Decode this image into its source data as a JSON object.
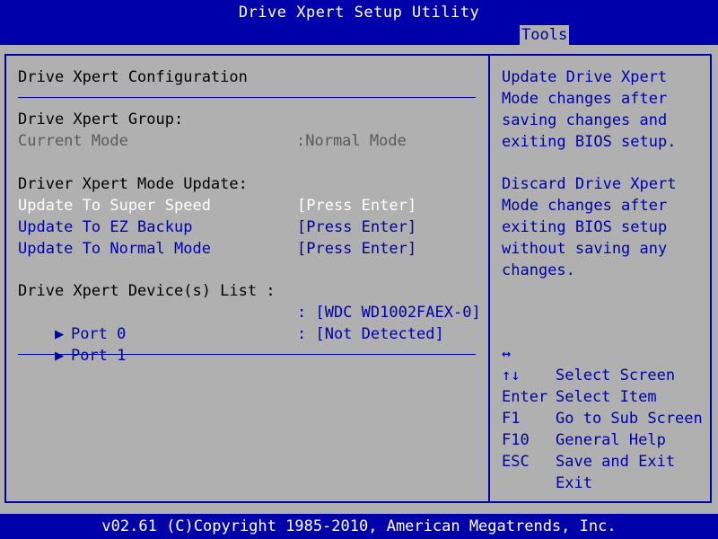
{
  "title": "Drive Xpert Setup Utility",
  "menu": {
    "active_tab": "Tools"
  },
  "left": {
    "section_title": "Drive Xpert Configuration",
    "group_header": "Drive Xpert Group:",
    "current_mode_label": "Current Mode",
    "current_mode_value": ":Normal Mode",
    "update_header": "Driver Xpert Mode Update:",
    "updates": [
      {
        "label": "Update To Super Speed",
        "value": "[Press Enter]"
      },
      {
        "label": "Update To EZ Backup",
        "value": "[Press Enter]"
      },
      {
        "label": "Update To Normal Mode",
        "value": "[Press Enter]"
      }
    ],
    "device_list_header": "Drive Xpert Device(s) List :",
    "ports": [
      {
        "arrow": "▶",
        "label": "Port 0",
        "value": ": [WDC WD1002FAEX-0]"
      },
      {
        "arrow": "▶",
        "label": "Port 1",
        "value": ": [Not Detected]"
      }
    ]
  },
  "help": {
    "paragraph1": "Update Drive Xpert Mode changes after saving changes and exiting BIOS setup.",
    "paragraph2": "Discard Drive Xpert Mode changes after exiting BIOS setup without saving any changes."
  },
  "keys": [
    {
      "key": "↔",
      "desc": "Select Screen"
    },
    {
      "key": "↑↓",
      "desc": "Select Item"
    },
    {
      "key": "Enter",
      "desc": "Go to Sub Screen"
    },
    {
      "key": "F1",
      "desc": "General Help"
    },
    {
      "key": "F10",
      "desc": "Save and Exit"
    },
    {
      "key": "ESC",
      "desc": "Exit"
    }
  ],
  "footer": "v02.61 (C)Copyright 1985-2010, American Megatrends, Inc.",
  "colors": {
    "bios_blue": "#0000aa",
    "panel_gray": "#b0b0b0",
    "highlight_white": "#ffffff"
  }
}
